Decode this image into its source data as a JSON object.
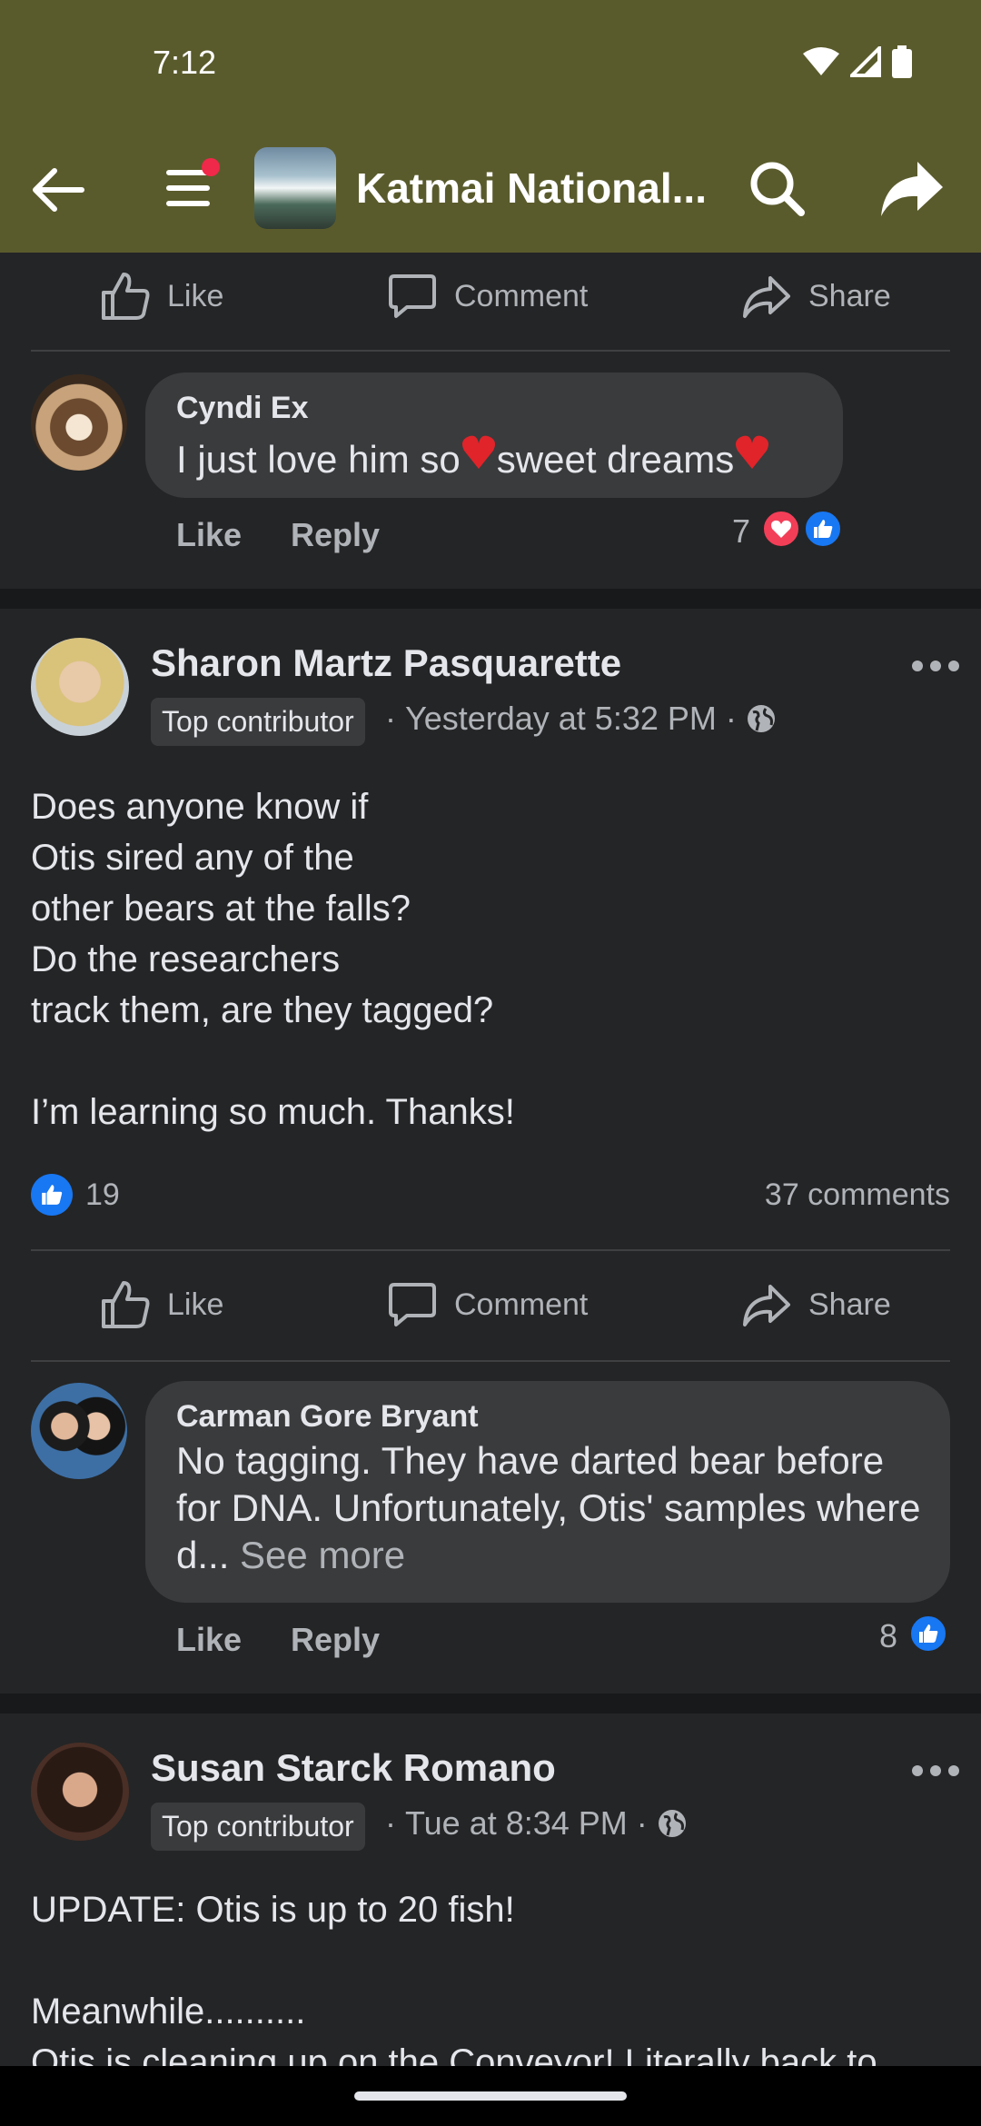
{
  "status": {
    "time": "7:12"
  },
  "header": {
    "title": "Katmai National..."
  },
  "actions": {
    "like": "Like",
    "comment": "Comment",
    "share": "Share"
  },
  "comment1": {
    "name": "Cyndi Ex",
    "text_a": "I just love him so",
    "text_b": "sweet dreams",
    "like": "Like",
    "reply": "Reply",
    "reaction_count": "7"
  },
  "post1": {
    "author": "Sharon Martz Pasquarette",
    "badge": "Top contributor",
    "time": "Yesterday at 5:32 PM",
    "body": "Does anyone know if\nOtis sired any of the\nother bears at the falls?\nDo the researchers\ntrack them, are they tagged?\n\nI’m learning so much. Thanks!",
    "like_count": "19",
    "comments_count": "37 comments"
  },
  "comment2": {
    "name": "Carman Gore Bryant",
    "text": "No tagging.  They have darted bear before for DNA.   Unfortunately,  Otis' samples where d...",
    "see_more": "See more",
    "like": "Like",
    "reply": "Reply",
    "reaction_count": "8"
  },
  "post2": {
    "author": "Susan Starck Romano",
    "badge": "Top contributor",
    "time": "Tue at 8:34 PM",
    "body": "UPDATE: Otis is up to 20 fish!\n\nMeanwhile..........\nOtis is cleaning up on the Conveyor! Literally back to"
  },
  "colors": {
    "like_blue": "#1877f2",
    "love_red": "#f33e58",
    "header_olive": "#5a5b2c"
  }
}
